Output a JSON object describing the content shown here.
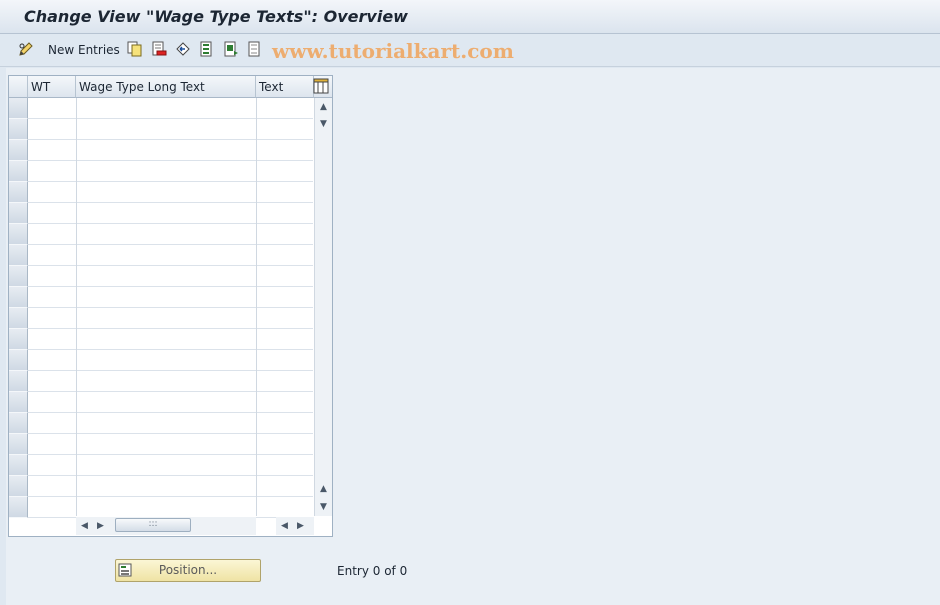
{
  "title": "Change View \"Wage Type Texts\": Overview",
  "toolbar": {
    "new_entries_label": "New Entries",
    "watermark": "www.tutorialkart.com",
    "icons": [
      "change-display-icon",
      "copy-icon",
      "delete-icon",
      "undo-icon",
      "select-all-icon",
      "select-block-icon",
      "deselect-all-icon"
    ]
  },
  "table": {
    "columns": [
      "WT",
      "Wage Type Long Text",
      "Text"
    ],
    "visible_rows": 20
  },
  "footer": {
    "position_label": "Position...",
    "entry_text": "Entry 0 of 0"
  }
}
